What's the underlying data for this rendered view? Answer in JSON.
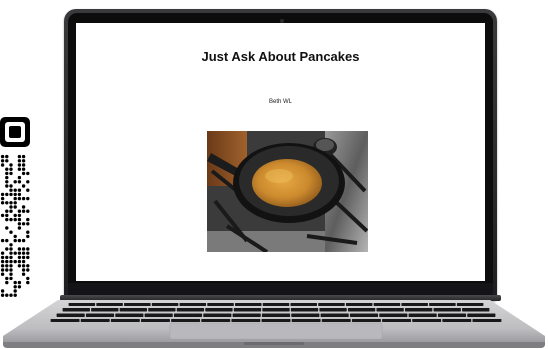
{
  "page": {
    "title": "Just Ask About Pancakes",
    "author": "Beth WL"
  },
  "image": {
    "subject": "pancake-in-frying-pan-on-gas-stove"
  },
  "colors": {
    "laptop_body": "#1e1e20",
    "deck_silver": "#c9c9cc",
    "keys": "#1a1a1c",
    "pancake": "#c88a2c",
    "pan": "#141414"
  }
}
